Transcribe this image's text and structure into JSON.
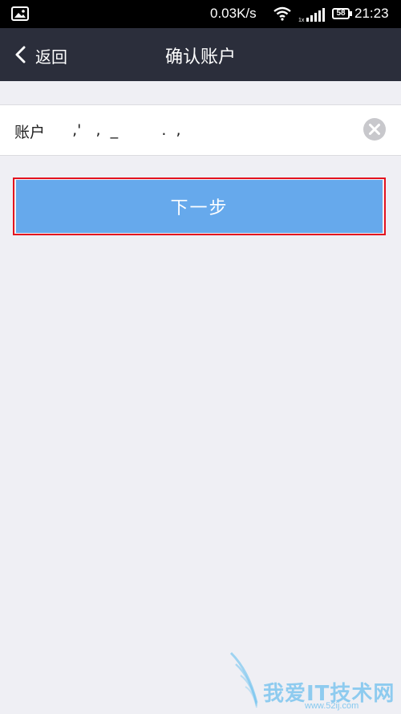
{
  "status_bar": {
    "net_speed": "0.03K/s",
    "battery": "58",
    "time": "21:23",
    "icons": [
      "gallery-icon",
      "wifi-icon",
      "signal-icon",
      "battery-icon"
    ]
  },
  "nav": {
    "back_label": "返回",
    "title": "确认账户"
  },
  "form": {
    "account_label": "账户",
    "account_value": "  ,'   ,  _         .  ,",
    "clear_icon": "clear-icon"
  },
  "actions": {
    "next_label": "下一步"
  },
  "watermark": {
    "text": "我爱IT技术网",
    "url": "www.52ij.com"
  },
  "colors": {
    "status_bar": "#000000",
    "nav_bar": "#2b2e3b",
    "background": "#efeff4",
    "primary_button": "#66a9ec",
    "highlight_border": "#e3121e"
  }
}
